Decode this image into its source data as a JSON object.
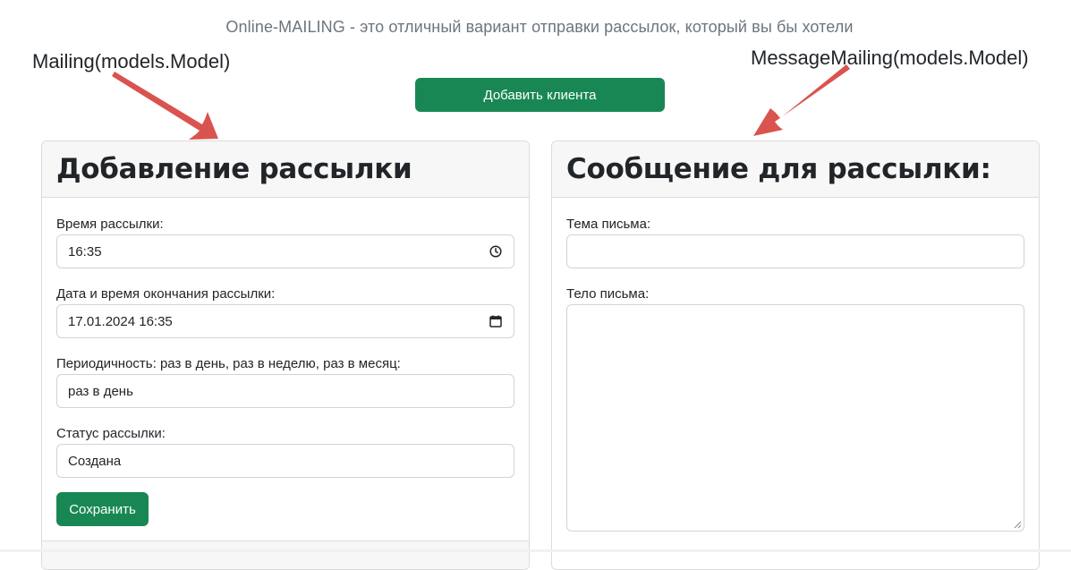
{
  "header": {
    "tagline": "Online-MAILING - это отличный вариант отправки рассылок, который вы бы хотели",
    "add_client_label": "Добавить клиента"
  },
  "annotations": {
    "left": "Mailing(models.Model)",
    "right": "MessageMailing(models.Model)",
    "arrow_color": "#d9534f"
  },
  "mailing_form": {
    "title": "Добавление рассылки",
    "time_label": "Время рассылки:",
    "time_value": "16:35",
    "end_label": "Дата и время окончания рассылки:",
    "end_value": "17.01.2024 16:35",
    "period_label": "Периодичность: раз в день, раз в неделю, раз в месяц:",
    "period_value": "раз в день",
    "status_label": "Статус рассылки:",
    "status_value": "Создана",
    "save_label": "Сохранить"
  },
  "message_form": {
    "title": "Сообщение для рассылки:",
    "subject_label": "Тема письма:",
    "subject_value": "",
    "body_label": "Тело письма:",
    "body_value": ""
  },
  "icons": {
    "time": "clock-icon",
    "datetime": "calendar-icon"
  },
  "colors": {
    "accent": "#198754",
    "arrow": "#d9534f"
  }
}
